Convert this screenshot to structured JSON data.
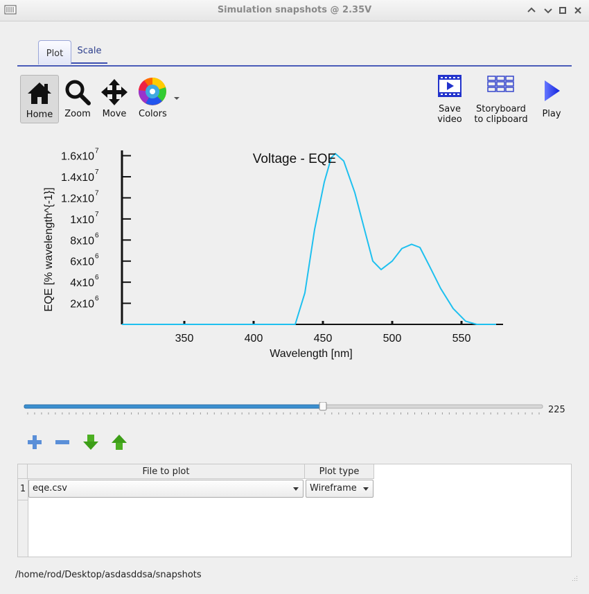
{
  "window": {
    "title": "Simulation snapshots @ 2.35V"
  },
  "tabs": [
    {
      "label": "Plot",
      "active": true
    },
    {
      "label": "Scale",
      "active": false
    }
  ],
  "toolbar": {
    "home": "Home",
    "zoom": "Zoom",
    "move": "Move",
    "colors": "Colors",
    "save_video_1": "Save",
    "save_video_2": "video",
    "storyboard_1": "Storyboard",
    "storyboard_2": "to clipboard",
    "play": "Play"
  },
  "chart_data": {
    "type": "line",
    "title": "Voltage - EQE",
    "xlabel": "Wavelength [nm]",
    "ylabel": "EQE [% wavelength^{-1}]",
    "xlim": [
      305,
      580
    ],
    "ylim": [
      0,
      16500000
    ],
    "x_ticks": [
      "350",
      "400",
      "450",
      "500",
      "550"
    ],
    "y_ticks": [
      {
        "base": "2x10",
        "exp": "6"
      },
      {
        "base": "4x10",
        "exp": "6"
      },
      {
        "base": "6x10",
        "exp": "6"
      },
      {
        "base": "8x10",
        "exp": "6"
      },
      {
        "base": "1x10",
        "exp": "7"
      },
      {
        "base": "1.2x10",
        "exp": "7"
      },
      {
        "base": "1.4x10",
        "exp": "7"
      },
      {
        "base": "1.6x10",
        "exp": "7"
      }
    ],
    "color": "#1ec0ef",
    "series": [
      {
        "x": [
          305,
          380,
          430,
          437,
          444,
          451,
          456,
          459,
          465,
          473,
          480,
          486,
          492,
          500,
          507,
          514,
          520,
          527,
          535,
          544,
          553,
          561,
          575
        ],
        "y": [
          0,
          0,
          0,
          3000000,
          9000000,
          13500000,
          15800000,
          16200000,
          15500000,
          12500000,
          9000000,
          6000000,
          5200000,
          6000000,
          7200000,
          7600000,
          7300000,
          5500000,
          3400000,
          1500000,
          300000,
          0,
          0
        ]
      }
    ]
  },
  "slider": {
    "value": "225",
    "fraction": 0.577
  },
  "table": {
    "headers": [
      "File to plot",
      "Plot type"
    ],
    "rows": [
      {
        "num": "1",
        "file": "eqe.csv",
        "plot_type": "Wireframe"
      }
    ]
  },
  "status": {
    "path": "/home/rod/Desktop/asdasddsa/snapshots"
  }
}
